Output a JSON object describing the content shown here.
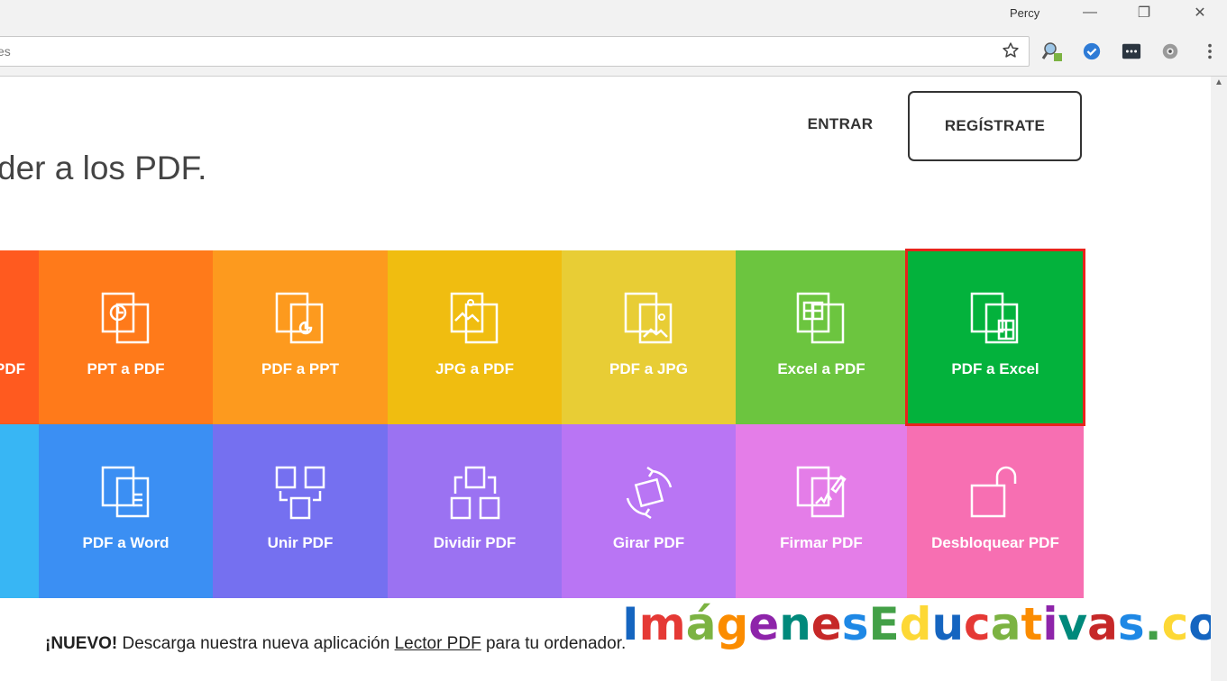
{
  "browser": {
    "profile_name": "Percy",
    "window_controls": {
      "minimize": "—",
      "restore": "❐",
      "close": "✕"
    },
    "address_bar_text": "es",
    "icons": [
      "bookmark-star-icon",
      "extension-search-icon",
      "extension-check-icon",
      "extension-dots-icon",
      "extension-gear-icon",
      "menu-kebab-icon"
    ]
  },
  "header": {
    "login_label": "ENTRAR",
    "signup_label": "REGÍSTRATE"
  },
  "hero": {
    "headline_fragment": "der a los PDF."
  },
  "tools": {
    "row1": [
      {
        "label": "PDF",
        "color": "#ff5a1f",
        "icon": "partial-tool-icon"
      },
      {
        "label": "PPT a PDF",
        "color": "#ff7a1a",
        "icon": "ppt-to-pdf-icon"
      },
      {
        "label": "PDF a PPT",
        "color": "#fd9a1e",
        "icon": "pdf-to-ppt-icon"
      },
      {
        "label": "JPG a PDF",
        "color": "#f0bd10",
        "icon": "jpg-to-pdf-icon"
      },
      {
        "label": "PDF a JPG",
        "color": "#e8cd35",
        "icon": "pdf-to-jpg-icon"
      },
      {
        "label": "Excel a PDF",
        "color": "#6cc53f",
        "icon": "excel-to-pdf-icon"
      },
      {
        "label": "PDF a Excel",
        "color": "#03b23c",
        "icon": "pdf-to-excel-icon"
      }
    ],
    "row2": [
      {
        "label": "",
        "color": "#38b6f4",
        "icon": "partial-tool-icon"
      },
      {
        "label": "PDF a Word",
        "color": "#3b8ff3",
        "icon": "pdf-to-word-icon"
      },
      {
        "label": "Unir PDF",
        "color": "#7570f0",
        "icon": "merge-pdf-icon"
      },
      {
        "label": "Dividir PDF",
        "color": "#9b72f2",
        "icon": "split-pdf-icon"
      },
      {
        "label": "Girar PDF",
        "color": "#b975f4",
        "icon": "rotate-pdf-icon"
      },
      {
        "label": "Firmar PDF",
        "color": "#e47de8",
        "icon": "sign-pdf-icon"
      },
      {
        "label": "Desbloquear PDF",
        "color": "#f76fb2",
        "icon": "unlock-pdf-icon"
      }
    ],
    "selected_label": "PDF a Excel",
    "selection_color": "#e8231c"
  },
  "notice": {
    "badge": "¡NUEVO!",
    "text_before_link": " Descarga nuestra nueva aplicación ",
    "link_text": "Lector PDF",
    "text_after_link": " para tu ordenador."
  },
  "watermark": {
    "text": "ImágenesEducativas.com",
    "colors": [
      "#1565c0",
      "#e53935",
      "#7cb342",
      "#fb8c00",
      "#8e24aa",
      "#00897b",
      "#c62828",
      "#1e88e5",
      "#43a047",
      "#fdd835"
    ]
  }
}
